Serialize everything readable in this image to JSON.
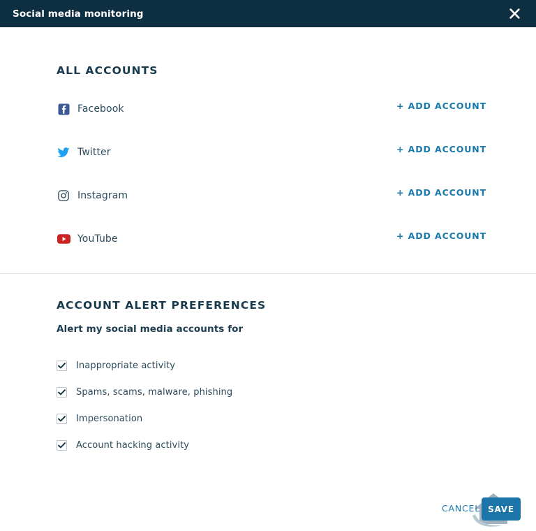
{
  "titlebar": {
    "title": "Social media monitoring",
    "close_icon": "close-icon"
  },
  "accounts_section": {
    "heading": "ALL ACCOUNTS",
    "rows": [
      {
        "name": "Facebook",
        "icon": "facebook-icon",
        "action": "+ ADD ACCOUNT"
      },
      {
        "name": "Twitter",
        "icon": "twitter-icon",
        "action": "+ ADD ACCOUNT"
      },
      {
        "name": "Instagram",
        "icon": "instagram-icon",
        "action": "+ ADD ACCOUNT"
      },
      {
        "name": "YouTube",
        "icon": "youtube-icon",
        "action": "+ ADD ACCOUNT"
      }
    ]
  },
  "preferences_section": {
    "heading": "ACCOUNT ALERT PREFERENCES",
    "subheading": "Alert my social media accounts for",
    "options": [
      {
        "label": "Inappropriate activity",
        "checked": true
      },
      {
        "label": "Spams, scams, malware, phishing",
        "checked": true
      },
      {
        "label": "Impersonation",
        "checked": true
      },
      {
        "label": "Account hacking activity",
        "checked": true
      }
    ]
  },
  "footer": {
    "logo_icon": "house-logo-icon",
    "cancel_label": "CANCEL",
    "save_label": "SAVE"
  },
  "colors": {
    "header_bg": "#0e2f41",
    "heading_text": "#173a4d",
    "link_blue": "#1a79ad",
    "save_button": "#1b75a8",
    "facebook_blue": "#3b5998",
    "twitter_blue": "#1da1f2",
    "instagram_dark": "#2c4a5c",
    "youtube_red": "#cc2420",
    "divider": "#e3e6e8",
    "logo_gray_blue": "#9fb2bd"
  }
}
